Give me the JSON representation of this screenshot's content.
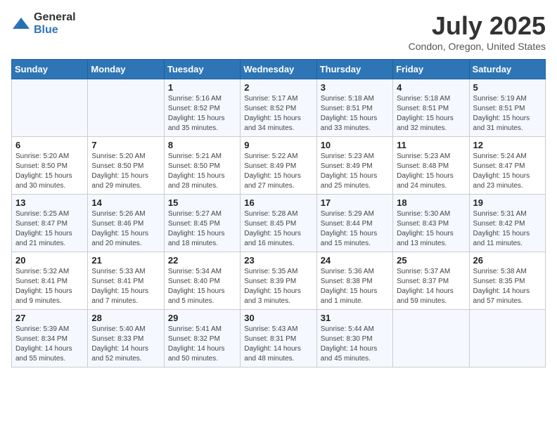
{
  "logo": {
    "general": "General",
    "blue": "Blue"
  },
  "title": {
    "month": "July 2025",
    "location": "Condon, Oregon, United States"
  },
  "weekdays": [
    "Sunday",
    "Monday",
    "Tuesday",
    "Wednesday",
    "Thursday",
    "Friday",
    "Saturday"
  ],
  "weeks": [
    [
      {
        "day": "",
        "info": ""
      },
      {
        "day": "",
        "info": ""
      },
      {
        "day": "1",
        "info": "Sunrise: 5:16 AM\nSunset: 8:52 PM\nDaylight: 15 hours\nand 35 minutes."
      },
      {
        "day": "2",
        "info": "Sunrise: 5:17 AM\nSunset: 8:52 PM\nDaylight: 15 hours\nand 34 minutes."
      },
      {
        "day": "3",
        "info": "Sunrise: 5:18 AM\nSunset: 8:51 PM\nDaylight: 15 hours\nand 33 minutes."
      },
      {
        "day": "4",
        "info": "Sunrise: 5:18 AM\nSunset: 8:51 PM\nDaylight: 15 hours\nand 32 minutes."
      },
      {
        "day": "5",
        "info": "Sunrise: 5:19 AM\nSunset: 8:51 PM\nDaylight: 15 hours\nand 31 minutes."
      }
    ],
    [
      {
        "day": "6",
        "info": "Sunrise: 5:20 AM\nSunset: 8:50 PM\nDaylight: 15 hours\nand 30 minutes."
      },
      {
        "day": "7",
        "info": "Sunrise: 5:20 AM\nSunset: 8:50 PM\nDaylight: 15 hours\nand 29 minutes."
      },
      {
        "day": "8",
        "info": "Sunrise: 5:21 AM\nSunset: 8:50 PM\nDaylight: 15 hours\nand 28 minutes."
      },
      {
        "day": "9",
        "info": "Sunrise: 5:22 AM\nSunset: 8:49 PM\nDaylight: 15 hours\nand 27 minutes."
      },
      {
        "day": "10",
        "info": "Sunrise: 5:23 AM\nSunset: 8:49 PM\nDaylight: 15 hours\nand 25 minutes."
      },
      {
        "day": "11",
        "info": "Sunrise: 5:23 AM\nSunset: 8:48 PM\nDaylight: 15 hours\nand 24 minutes."
      },
      {
        "day": "12",
        "info": "Sunrise: 5:24 AM\nSunset: 8:47 PM\nDaylight: 15 hours\nand 23 minutes."
      }
    ],
    [
      {
        "day": "13",
        "info": "Sunrise: 5:25 AM\nSunset: 8:47 PM\nDaylight: 15 hours\nand 21 minutes."
      },
      {
        "day": "14",
        "info": "Sunrise: 5:26 AM\nSunset: 8:46 PM\nDaylight: 15 hours\nand 20 minutes."
      },
      {
        "day": "15",
        "info": "Sunrise: 5:27 AM\nSunset: 8:45 PM\nDaylight: 15 hours\nand 18 minutes."
      },
      {
        "day": "16",
        "info": "Sunrise: 5:28 AM\nSunset: 8:45 PM\nDaylight: 15 hours\nand 16 minutes."
      },
      {
        "day": "17",
        "info": "Sunrise: 5:29 AM\nSunset: 8:44 PM\nDaylight: 15 hours\nand 15 minutes."
      },
      {
        "day": "18",
        "info": "Sunrise: 5:30 AM\nSunset: 8:43 PM\nDaylight: 15 hours\nand 13 minutes."
      },
      {
        "day": "19",
        "info": "Sunrise: 5:31 AM\nSunset: 8:42 PM\nDaylight: 15 hours\nand 11 minutes."
      }
    ],
    [
      {
        "day": "20",
        "info": "Sunrise: 5:32 AM\nSunset: 8:41 PM\nDaylight: 15 hours\nand 9 minutes."
      },
      {
        "day": "21",
        "info": "Sunrise: 5:33 AM\nSunset: 8:41 PM\nDaylight: 15 hours\nand 7 minutes."
      },
      {
        "day": "22",
        "info": "Sunrise: 5:34 AM\nSunset: 8:40 PM\nDaylight: 15 hours\nand 5 minutes."
      },
      {
        "day": "23",
        "info": "Sunrise: 5:35 AM\nSunset: 8:39 PM\nDaylight: 15 hours\nand 3 minutes."
      },
      {
        "day": "24",
        "info": "Sunrise: 5:36 AM\nSunset: 8:38 PM\nDaylight: 15 hours\nand 1 minute."
      },
      {
        "day": "25",
        "info": "Sunrise: 5:37 AM\nSunset: 8:37 PM\nDaylight: 14 hours\nand 59 minutes."
      },
      {
        "day": "26",
        "info": "Sunrise: 5:38 AM\nSunset: 8:35 PM\nDaylight: 14 hours\nand 57 minutes."
      }
    ],
    [
      {
        "day": "27",
        "info": "Sunrise: 5:39 AM\nSunset: 8:34 PM\nDaylight: 14 hours\nand 55 minutes."
      },
      {
        "day": "28",
        "info": "Sunrise: 5:40 AM\nSunset: 8:33 PM\nDaylight: 14 hours\nand 52 minutes."
      },
      {
        "day": "29",
        "info": "Sunrise: 5:41 AM\nSunset: 8:32 PM\nDaylight: 14 hours\nand 50 minutes."
      },
      {
        "day": "30",
        "info": "Sunrise: 5:43 AM\nSunset: 8:31 PM\nDaylight: 14 hours\nand 48 minutes."
      },
      {
        "day": "31",
        "info": "Sunrise: 5:44 AM\nSunset: 8:30 PM\nDaylight: 14 hours\nand 45 minutes."
      },
      {
        "day": "",
        "info": ""
      },
      {
        "day": "",
        "info": ""
      }
    ]
  ]
}
